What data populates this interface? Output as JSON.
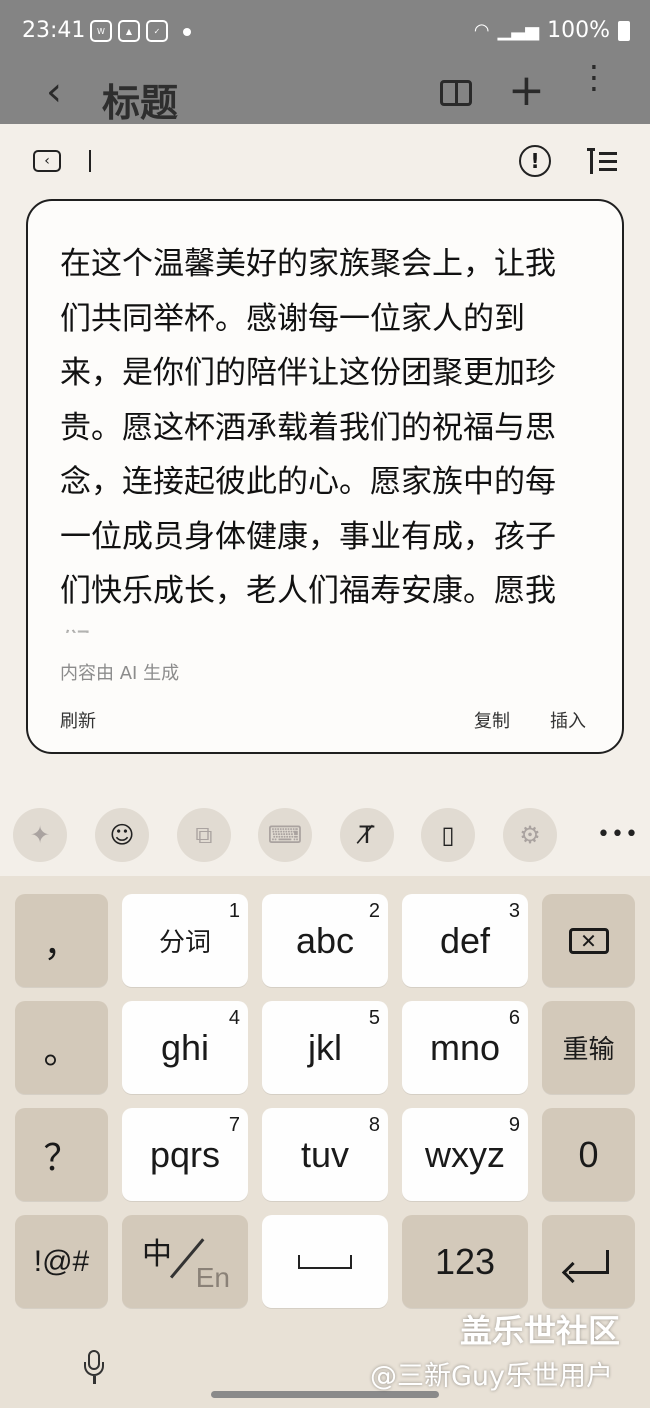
{
  "status_bar": {
    "time": "23:41",
    "notification_icons": [
      "wear-icon",
      "gallery-icon",
      "check-shield-icon"
    ],
    "battery": "100%"
  },
  "app_bar": {
    "title": "标题",
    "back_icon": "chevron-left-icon",
    "actions": [
      "book-icon",
      "plus-icon",
      "more-vertical-icon"
    ]
  },
  "editor_toolbar": {
    "left_icon": "collapse-toolbar-icon",
    "right_icons": [
      "alert-circle-icon",
      "format-list-icon"
    ]
  },
  "ai_card": {
    "text": "在这个温馨美好的家族聚会上，让我们共同举杯。感谢每一位家人的到来，是你们的陪伴让这份团聚更加珍贵。愿这杯酒承载着我们的祝福与思念，连接起彼此的心。愿家族中的每一位成员身体健康，事业有成，孩子们快乐成长，老人们福寿安康。愿我们",
    "source_label": "内容由 AI 生成",
    "refresh_label": "刷新",
    "copy_label": "复制",
    "insert_label": "插入"
  },
  "keyboard_toolbar": {
    "items": [
      "ai-sparkle-icon",
      "emoji-icon",
      "translate-icon",
      "keyboard-layout-icon",
      "handwriting-icon",
      "clipboard-icon",
      "settings-icon",
      "more-horizontal-icon"
    ]
  },
  "keyboard": {
    "row1": {
      "punct": "，",
      "k1": "分词",
      "k1n": "1",
      "k2": "abc",
      "k2n": "2",
      "k3": "def",
      "k3n": "3"
    },
    "row2": {
      "punct": "。",
      "k1": "ghi",
      "k1n": "4",
      "k2": "jkl",
      "k2n": "5",
      "k3": "mno",
      "k3n": "6",
      "side": "重输"
    },
    "row3": {
      "punct": "？",
      "k1": "pqrs",
      "k1n": "7",
      "k2": "tuv",
      "k2n": "8",
      "k3": "wxyz",
      "k3n": "9",
      "side": "0"
    },
    "row4": {
      "sym": "!@#",
      "lang_zh": "中",
      "lang_en": "En",
      "num": "123"
    }
  },
  "watermark": {
    "line1": "盖乐世社区",
    "line2": "@三新Guy乐世用户"
  }
}
